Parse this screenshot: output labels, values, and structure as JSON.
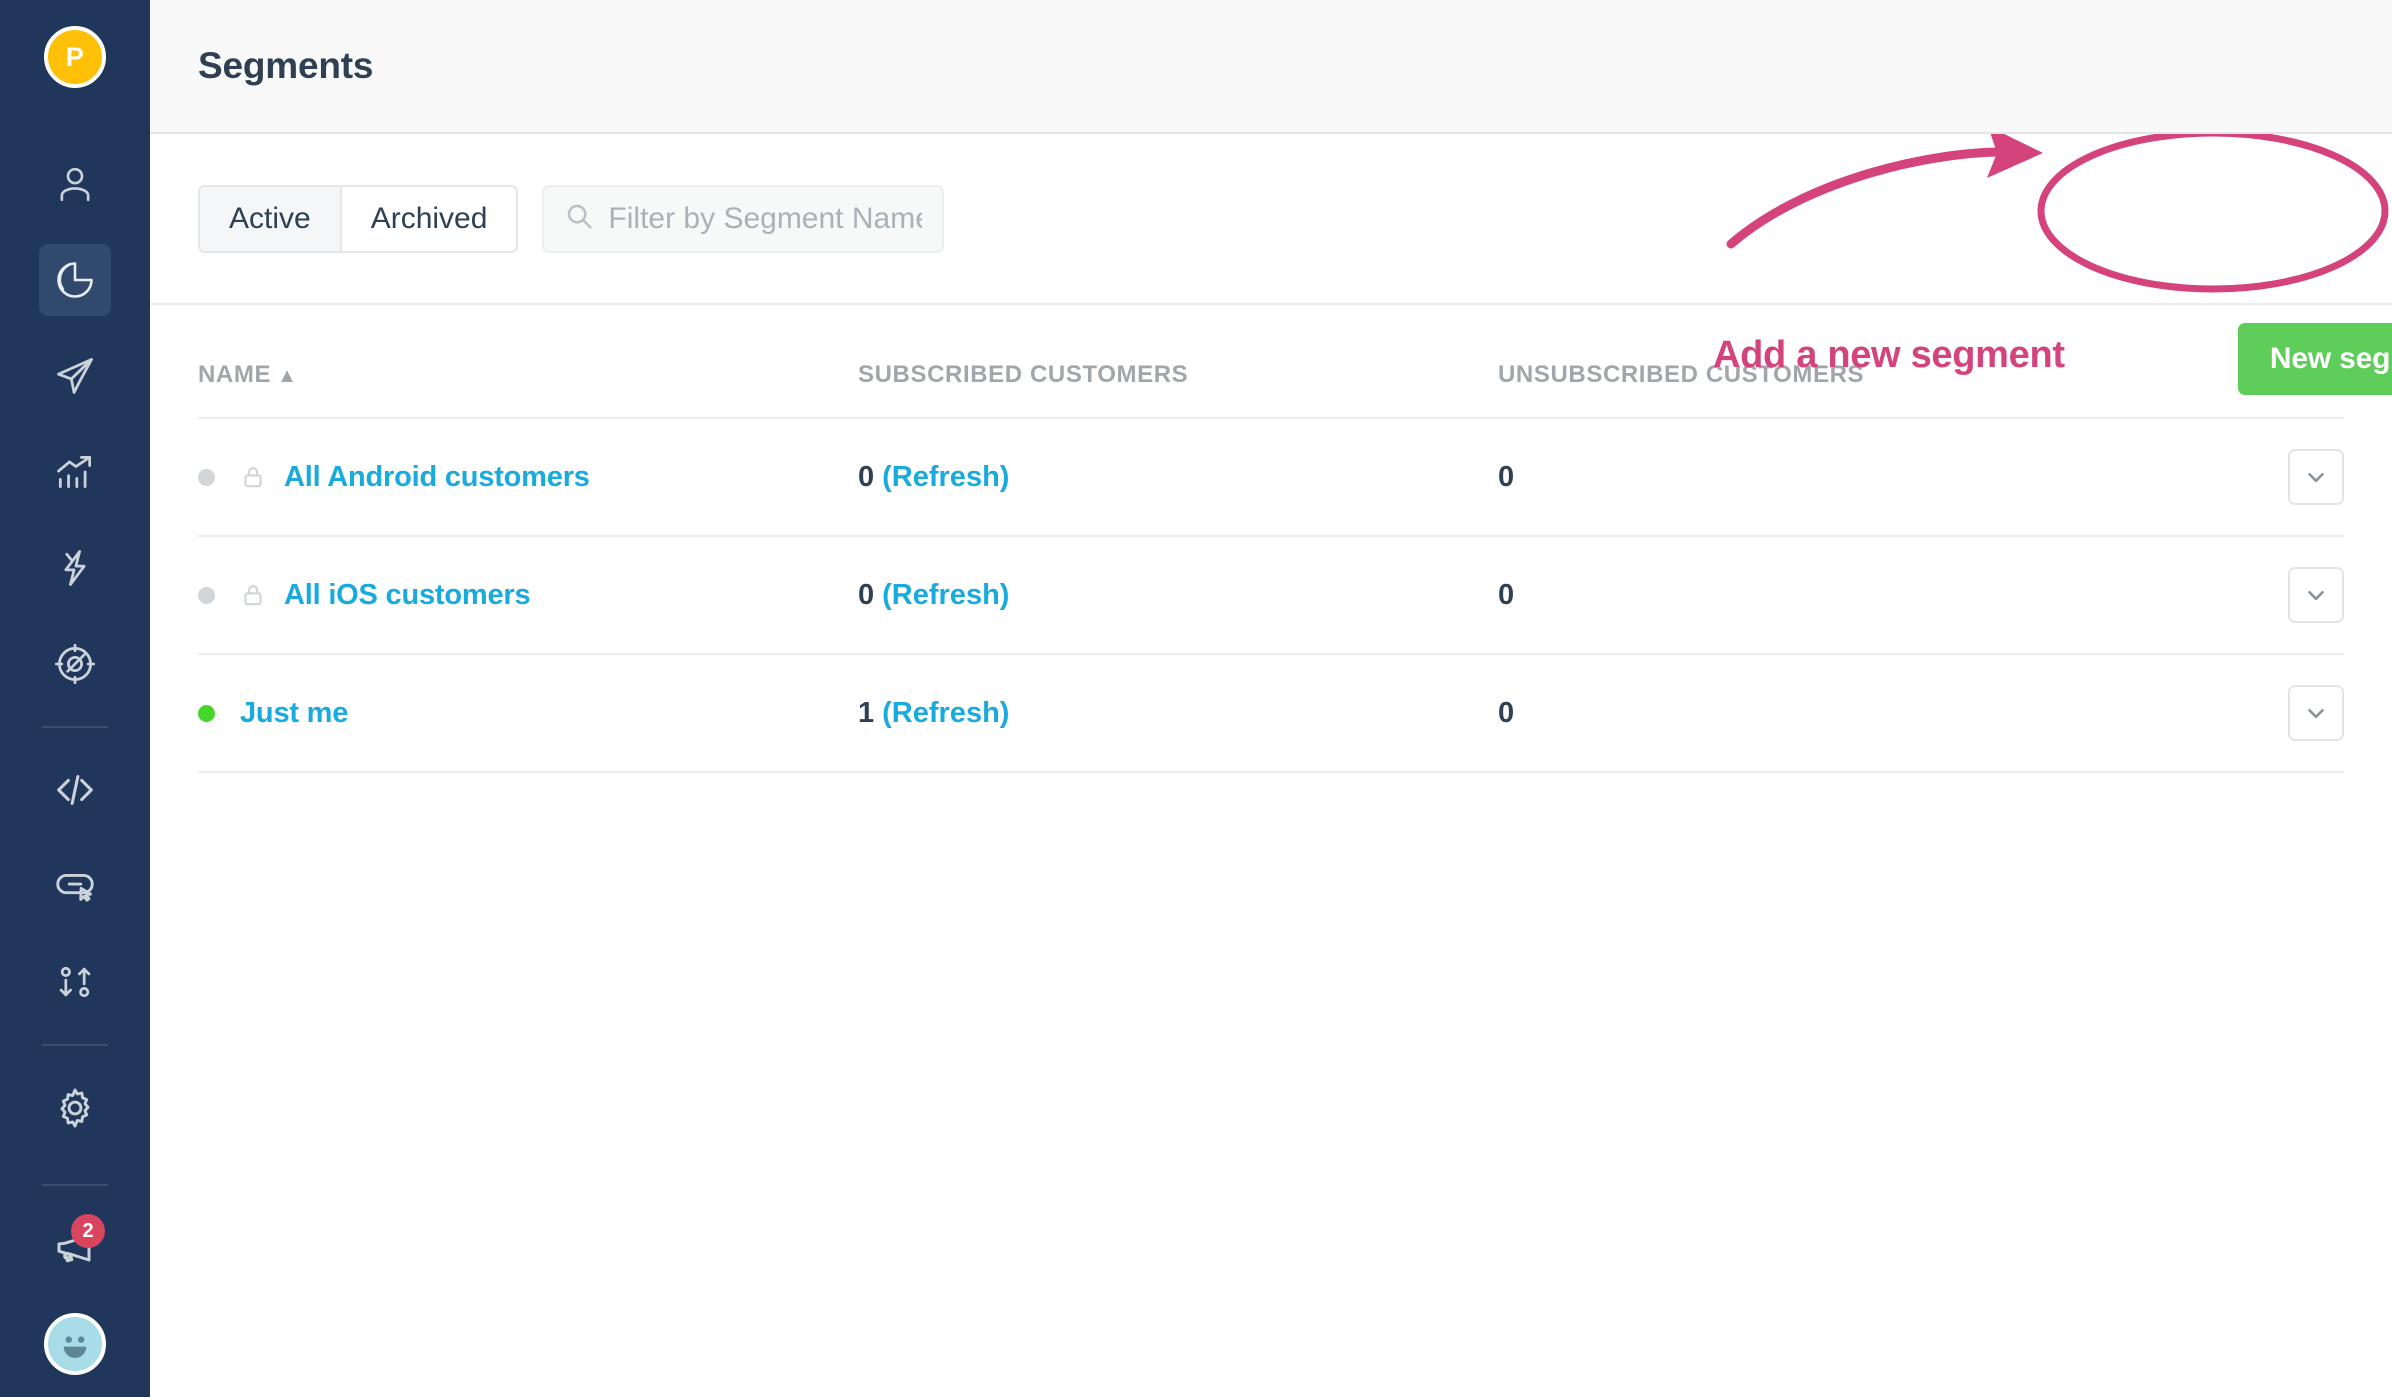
{
  "sidebar": {
    "avatar_initial": "P",
    "items": [
      {
        "icon": "person-icon",
        "name": "people",
        "active": false
      },
      {
        "icon": "pie-chart-icon",
        "name": "segments",
        "active": true
      },
      {
        "icon": "paper-plane-icon",
        "name": "campaigns",
        "active": false
      },
      {
        "icon": "growth-chart-icon",
        "name": "metrics",
        "active": false
      },
      {
        "icon": "lightning-bolt-icon",
        "name": "automations",
        "active": false
      },
      {
        "icon": "globe-target-icon",
        "name": "broadcasts",
        "active": false
      },
      {
        "icon": "code-brackets-icon",
        "name": "developers",
        "active": false
      },
      {
        "icon": "chat-cursor-icon",
        "name": "messages",
        "active": false
      },
      {
        "icon": "import-export-icon",
        "name": "data-transfer",
        "active": false
      },
      {
        "icon": "gear-icon",
        "name": "settings",
        "active": false
      }
    ],
    "notifications": {
      "icon": "megaphone-icon",
      "badge_count": "2"
    },
    "support": {
      "icon": "smiley-face-icon"
    }
  },
  "header": {
    "title": "Segments"
  },
  "toolbar": {
    "tabs": [
      {
        "label": "Active",
        "selected": true
      },
      {
        "label": "Archived",
        "selected": false
      }
    ],
    "filter": {
      "placeholder": "Filter by Segment Name",
      "value": "",
      "icon": "search-icon"
    },
    "new_segment_label": "New segment"
  },
  "annotation": {
    "text": "Add a new segment",
    "color": "#D4437B",
    "shapes": [
      "curved-arrow",
      "ellipse-highlight"
    ]
  },
  "table": {
    "columns": [
      {
        "label": "NAME",
        "sort": "▲"
      },
      {
        "label": "SUBSCRIBED CUSTOMERS"
      },
      {
        "label": "UNSUBSCRIBED CUSTOMERS"
      }
    ],
    "rows": [
      {
        "status": "grey",
        "locked": true,
        "name": "All Android customers",
        "subscribed": "0",
        "refresh_label": "(Refresh)",
        "unsubscribed": "0",
        "menu_icon": "chevron-down-icon"
      },
      {
        "status": "grey",
        "locked": true,
        "name": "All iOS customers",
        "subscribed": "0",
        "refresh_label": "(Refresh)",
        "unsubscribed": "0",
        "menu_icon": "chevron-down-icon"
      },
      {
        "status": "green",
        "locked": false,
        "name": "Just me",
        "subscribed": "1",
        "refresh_label": "(Refresh)",
        "unsubscribed": "0",
        "menu_icon": "chevron-down-icon"
      }
    ]
  },
  "colors": {
    "sidebar_bg": "#20365A",
    "accent_green": "#5ECD5A",
    "link_blue": "#19AADE",
    "annotation_pink": "#D4437B",
    "avatar_yellow": "#FFC107",
    "badge_red": "#D9455F"
  }
}
